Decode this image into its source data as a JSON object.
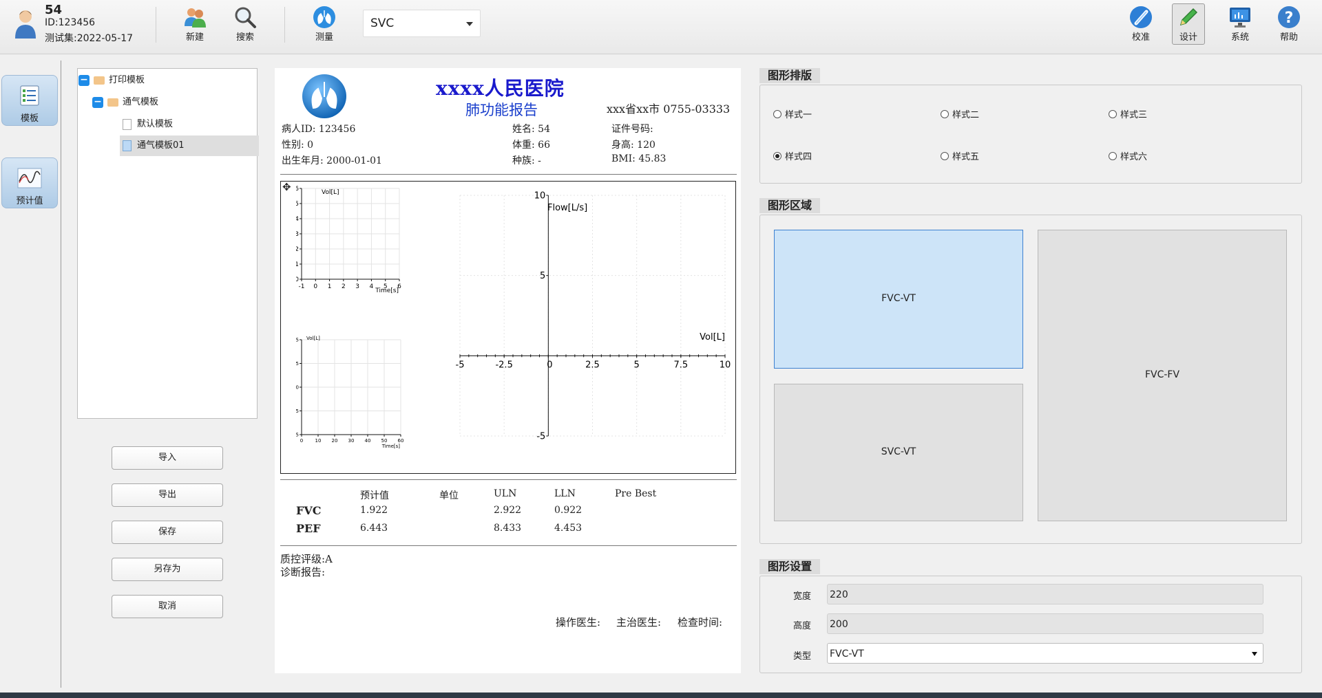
{
  "user": {
    "name": "54",
    "id_line": "ID:123456",
    "date_line": "测试集:2022-05-17"
  },
  "toolbar": {
    "new_label": "新建",
    "search_label": "搜索",
    "measure_label": "测量",
    "mode_value": "SVC",
    "calibrate_label": "校准",
    "design_label": "设计",
    "system_label": "系统",
    "help_label": "帮助"
  },
  "nav": {
    "template_label": "模板",
    "predicted_label": "预计值"
  },
  "tree": {
    "root": "打印模板",
    "group": "通气模板",
    "item1": "默认模板",
    "item2": "通气模板01"
  },
  "buttons": {
    "import": "导入",
    "export": "导出",
    "save": "保存",
    "save_as": "另存为",
    "cancel": "取消"
  },
  "report": {
    "hospital": "xxxx人民医院",
    "subtitle": "肺功能报告",
    "contact": "xxx省xx市 0755-03333",
    "info": {
      "patient_id": "病人ID:  123456",
      "gender": "性别:  0",
      "birth": "出生年月:  2000-01-01",
      "name": "姓名:  54",
      "weight": "体重:  66",
      "ethnicity": "种族:  -",
      "cert": "证件号码:",
      "height": "身高:  120",
      "bmi": "BMI:  45.83"
    },
    "table": {
      "headers": [
        "预计值",
        "单位",
        "ULN",
        "LLN",
        "Pre Best"
      ],
      "rows": [
        {
          "name": "FVC",
          "pred": "1.922",
          "unit": "",
          "uln": "2.922",
          "lln": "0.922",
          "best": ""
        },
        {
          "name": "PEF",
          "pred": "6.443",
          "unit": "",
          "uln": "8.433",
          "lln": "4.453",
          "best": ""
        }
      ]
    },
    "qc": "质控评级:A",
    "diagnosis": "诊断报告:",
    "operator": "操作医生:",
    "doctor": "主治医生:",
    "exam_time": "检查时间:"
  },
  "chart_data": [
    {
      "type": "line",
      "title": "",
      "xlabel": "Time[s]",
      "ylabel": "Vol[L]",
      "xlim": [
        -1,
        6
      ],
      "ylim": [
        0,
        6
      ],
      "xticks": [
        "-1",
        "0",
        "1",
        "2",
        "3",
        "4",
        "5",
        "6"
      ],
      "yticks": [
        "0",
        "1",
        "2",
        "3",
        "4",
        "5",
        "6"
      ],
      "grid": true,
      "series": []
    },
    {
      "type": "line",
      "title": "",
      "xlabel": "Time[s]",
      "ylabel": "Vol[L]",
      "xlim": [
        0,
        60
      ],
      "ylim": [
        -5,
        5
      ],
      "xticks": [
        "0",
        "10",
        "20",
        "30",
        "40",
        "50",
        "60"
      ],
      "yticks": [
        "-5",
        "-2.5",
        "0",
        "2.5",
        "5"
      ],
      "grid": true,
      "series": []
    },
    {
      "type": "line",
      "title": "",
      "xlabel": "Vol[L]",
      "ylabel": "Flow[L/s]",
      "xlim": [
        -5,
        10
      ],
      "ylim": [
        -5,
        10
      ],
      "xticks": [
        "-5",
        "-2.5",
        "0",
        "2.5",
        "5",
        "7.5",
        "10"
      ],
      "yticks": [
        "-5",
        "0",
        "5",
        "10"
      ],
      "grid": true,
      "series": []
    }
  ],
  "layout_panel": {
    "title": "图形排版",
    "options": [
      "样式一",
      "样式二",
      "样式三",
      "样式四",
      "样式五",
      "样式六"
    ],
    "selected": "样式四"
  },
  "area_panel": {
    "title": "图形区域",
    "area1": "FVC-VT",
    "area2": "SVC-VT",
    "area3": "FVC-FV"
  },
  "settings_panel": {
    "title": "图形设置",
    "width_label": "宽度",
    "width_value": "220",
    "height_label": "高度",
    "height_value": "200",
    "type_label": "类型",
    "type_value": "FVC-VT"
  }
}
